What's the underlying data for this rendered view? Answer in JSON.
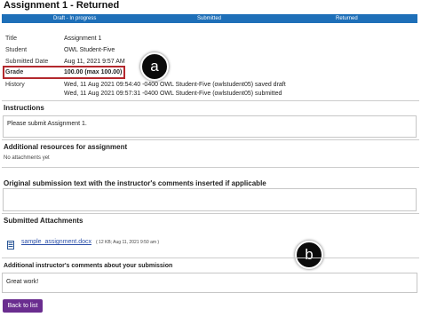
{
  "page": {
    "title": "Assignment 1 - Returned"
  },
  "progress": {
    "steps": [
      "Draft - In progress",
      "Submitted",
      "Returned"
    ],
    "accent": "#1e6fb8"
  },
  "details": {
    "title_label": "Title",
    "title_value": "Assignment 1",
    "student_label": "Student",
    "student_value": "OWL Student-Five",
    "submitted_label": "Submitted Date",
    "submitted_value": "Aug 11, 2021 9:57 AM",
    "grade_label": "Grade",
    "grade_value": "100.00 (max 100.00)",
    "history_label": "History",
    "history": [
      "Wed, 11 Aug 2021 09:54:40 -0400 OWL Student-Five (owlstudent05) saved draft",
      "Wed, 11 Aug 2021 09:57:31 -0400 OWL Student-Five (owlstudent05) submitted"
    ]
  },
  "callouts": {
    "a": "a",
    "b": "b",
    "highlight_color": "#b3282d"
  },
  "instructions": {
    "title": "Instructions",
    "text": "Please submit Assignment 1."
  },
  "resources": {
    "title": "Additional resources for assignment",
    "text": "No attachments yet"
  },
  "original": {
    "title": "Original submission text with the instructor's comments inserted if applicable"
  },
  "attachments": {
    "title": "Submitted Attachments",
    "icon": "word-document-icon",
    "file_name": "sample_assignment.docx",
    "file_meta": "( 12 KB; Aug 11, 2021 9:50 am )"
  },
  "comments": {
    "title": "Additional instructor's comments about your submission",
    "text": "Great work!"
  },
  "buttons": {
    "back": "Back to list",
    "back_color": "#6a2d8f"
  }
}
